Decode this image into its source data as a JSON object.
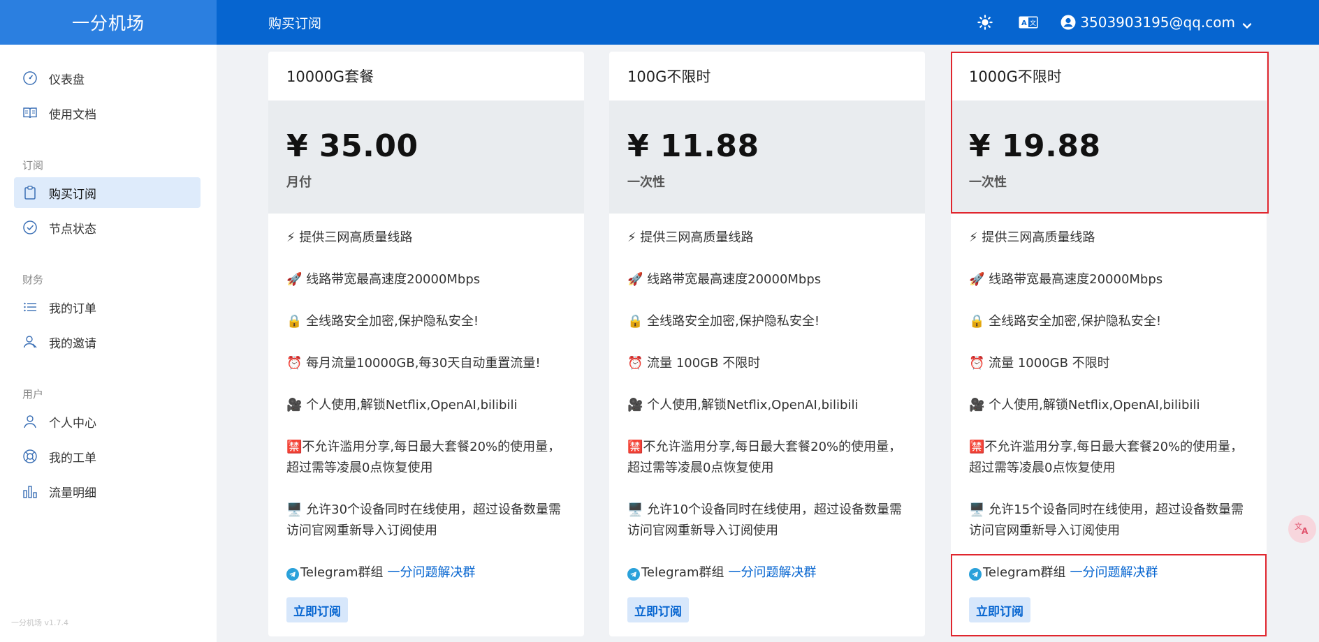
{
  "header": {
    "brand": "一分机场",
    "page_title": "购买订阅",
    "user_email": "3503903195@qq.com"
  },
  "sidebar": {
    "items_top": [
      {
        "label": "仪表盘",
        "icon": "dashboard-icon"
      },
      {
        "label": "使用文档",
        "icon": "book-icon"
      }
    ],
    "group_subscribe": "订阅",
    "items_subscribe": [
      {
        "label": "购买订阅",
        "icon": "clipboard-icon",
        "active": true
      },
      {
        "label": "节点状态",
        "icon": "check-circle-icon"
      }
    ],
    "group_finance": "财务",
    "items_finance": [
      {
        "label": "我的订单",
        "icon": "list-icon"
      },
      {
        "label": "我的邀请",
        "icon": "user-invite-icon"
      }
    ],
    "group_user": "用户",
    "items_user": [
      {
        "label": "个人中心",
        "icon": "user-icon"
      },
      {
        "label": "我的工单",
        "icon": "lifebuoy-icon"
      },
      {
        "label": "流量明细",
        "icon": "bar-chart-icon"
      }
    ],
    "version": "一分机场 v1.7.4"
  },
  "plans": [
    {
      "name": "10000G套餐",
      "price": "¥ 35.00",
      "period": "月付",
      "features": [
        "⚡ 提供三网高质量线路",
        "🚀 线路带宽最高速度20000Mbps",
        "🔒 全线路安全加密,保护隐私安全!",
        "⏰ 每月流量10000GB,每30天自动重置流量!",
        "🎥 个人使用,解锁Netflix,OpenAI,bilibili",
        "🈲不允许滥用分享,每日最大套餐20%的使用量，超过需等凌晨0点恢复使用",
        "🖥️ 允许30个设备同时在线使用，超过设备数量需访问官网重新导入订阅使用"
      ],
      "telegram_label": "Telegram群组",
      "telegram_link": "一分问题解决群",
      "button": "立即订阅"
    },
    {
      "name": "100G不限时",
      "price": "¥ 11.88",
      "period": "一次性",
      "features": [
        "⚡ 提供三网高质量线路",
        "🚀 线路带宽最高速度20000Mbps",
        "🔒 全线路安全加密,保护隐私安全!",
        "⏰ 流量 100GB 不限时",
        "🎥 个人使用,解锁Netflix,OpenAI,bilibili",
        "🈲不允许滥用分享,每日最大套餐20%的使用量，超过需等凌晨0点恢复使用",
        "🖥️ 允许10个设备同时在线使用，超过设备数量需访问官网重新导入订阅使用"
      ],
      "telegram_label": "Telegram群组",
      "telegram_link": "一分问题解决群",
      "button": "立即订阅"
    },
    {
      "name": "1000G不限时",
      "price": "¥ 19.88",
      "period": "一次性",
      "features": [
        "⚡ 提供三网高质量线路",
        "🚀 线路带宽最高速度20000Mbps",
        "🔒 全线路安全加密,保护隐私安全!",
        "⏰ 流量 1000GB 不限时",
        "🎥 个人使用,解锁Netflix,OpenAI,bilibili",
        "🈲不允许滥用分享,每日最大套餐20%的使用量，超过需等凌晨0点恢复使用",
        "🖥️ 允许15个设备同时在线使用，超过设备数量需访问官网重新导入订阅使用"
      ],
      "telegram_label": "Telegram群组",
      "telegram_link": "一分问题解决群",
      "button": "立即订阅"
    }
  ],
  "colors": {
    "header_bg": "#0665d0",
    "brand_bg": "#2b7fe0",
    "link": "#0665d0",
    "price_bg": "#e9ecef",
    "highlight": "#e0262e"
  }
}
